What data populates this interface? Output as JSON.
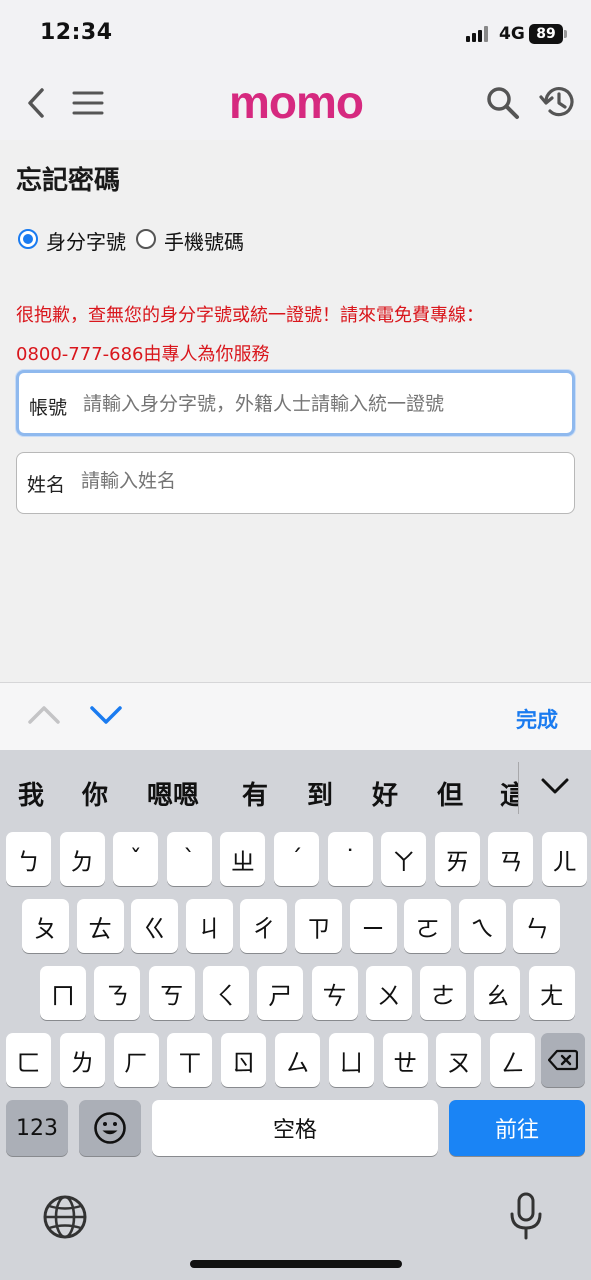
{
  "status_bar": {
    "time": "12:34",
    "network": "4G",
    "battery": "89"
  },
  "nav": {
    "logo": "momo"
  },
  "page": {
    "title": "忘記密碼",
    "radios": [
      {
        "label": "身分字號",
        "selected": true
      },
      {
        "label": "手機號碼",
        "selected": false
      }
    ],
    "error_line1": "很抱歉，查無您的身分字號或統一證號！請來電免費專線：",
    "error_line2": "0800-777-686由專人為你服務",
    "account_field": {
      "label": "帳號",
      "placeholder": "請輸入身分字號，外籍人士請輸入統一證號"
    },
    "name_field": {
      "label": "姓名",
      "placeholder": "請輸入姓名"
    }
  },
  "accessory": {
    "done": "完成"
  },
  "keyboard": {
    "candidates": [
      "我",
      "你",
      "嗯嗯",
      "有",
      "到",
      "好",
      "但",
      "這"
    ],
    "row1": [
      "ㄅ",
      "ㄉ",
      "ˇ",
      "ˋ",
      "ㄓ",
      "ˊ",
      "˙",
      "ㄚ",
      "ㄞ",
      "ㄢ",
      "ㄦ"
    ],
    "row2": [
      "ㄆ",
      "ㄊ",
      "ㄍ",
      "ㄐ",
      "ㄔ",
      "ㄗ",
      "ㄧ",
      "ㄛ",
      "ㄟ",
      "ㄣ"
    ],
    "row3": [
      "ㄇ",
      "ㄋ",
      "ㄎ",
      "ㄑ",
      "ㄕ",
      "ㄘ",
      "ㄨ",
      "ㄜ",
      "ㄠ",
      "ㄤ"
    ],
    "row4": [
      "ㄈ",
      "ㄌ",
      "ㄏ",
      "ㄒ",
      "ㄖ",
      "ㄙ",
      "ㄩ",
      "ㄝ",
      "ㄡ",
      "ㄥ"
    ],
    "numbers": "123",
    "space": "空格",
    "go": "前往"
  },
  "colors": {
    "brand": "#d6297f",
    "accent": "#1a7bf0",
    "error": "#d9161c"
  }
}
